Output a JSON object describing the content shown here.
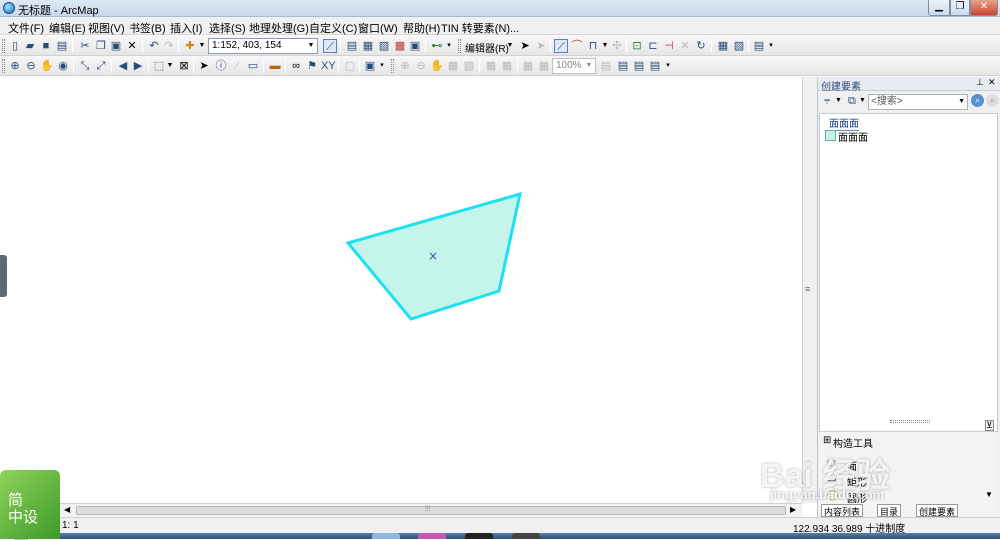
{
  "window": {
    "title": "无标题 - ArcMap",
    "minimize_icon": "minimize-icon",
    "maximize_icon": "maximize-icon",
    "close_icon": "close-icon"
  },
  "menu": {
    "items": [
      "文件(F)",
      "编辑(E)",
      "视图(V)",
      "书签(B)",
      "插入(I)",
      "选择(S)",
      "地理处理(G)",
      "自定义(C)",
      "窗口(W)",
      "帮助(H)",
      "TIN 转要素(N)..."
    ]
  },
  "toolbar": {
    "scale_value": "1:152, 403, 154",
    "editor_label": "编辑器(R)",
    "zoom_value": "100%"
  },
  "map": {
    "polygon_fill": "#c5f5ea",
    "polygon_stroke": "#1ee0f0",
    "vertex_marker": "×"
  },
  "panel": {
    "title": "创建要素",
    "pin_icon": "pin-icon",
    "close_icon": "close-icon",
    "search_placeholder": "<搜索>",
    "group_label": "面面面",
    "template_label": "面面面",
    "construct_title": "构造工具",
    "tools": [
      "面",
      "矩形",
      "圆形"
    ],
    "bottom_tabs": [
      "内容列表",
      "目录",
      "创建要素"
    ]
  },
  "status": {
    "left_text": "1: 1",
    "coordinates": "122.934  36.989 十进制度"
  },
  "watermark": {
    "logo_text": "简\n中设",
    "brand": "Bai 经验",
    "domain": "jingyan.baidu.com"
  }
}
